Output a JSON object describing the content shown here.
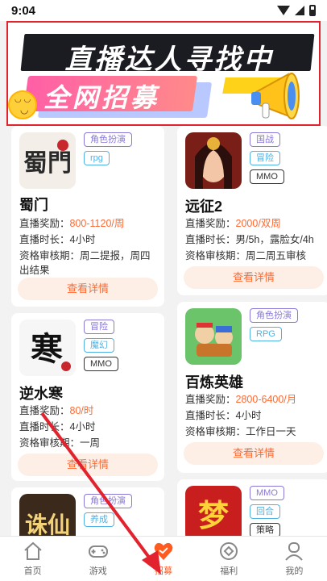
{
  "status": {
    "time": "9:04"
  },
  "banner": {
    "title": "直播达人寻找中",
    "subtitle": "全网招募"
  },
  "games": [
    {
      "name": "蜀门",
      "tags": [
        "角色扮演",
        "rpg"
      ],
      "reward_label": "直播奖励：",
      "reward": "800-1120/周",
      "duration": "直播时长：4小时",
      "review": "资格审核期：周二提报，周四出结果",
      "button": "查看详情"
    },
    {
      "name": "远征2",
      "tags": [
        "国战",
        "冒险",
        "MMO"
      ],
      "reward_label": "直播奖励：",
      "reward": "2000/双周",
      "duration": "直播时长：男/5h，露脸女/4h",
      "review": "资格审核期：周二周五审核",
      "button": "查看详情"
    },
    {
      "name": "逆水寒",
      "tags": [
        "冒险",
        "魔幻",
        "MMO"
      ],
      "reward_label": "直播奖励：",
      "reward": "80/时",
      "duration": "直播时长：4小时",
      "review": "资格审核期：一周",
      "button": "查看详情"
    },
    {
      "name": "百炼英雄",
      "tags": [
        "角色扮演",
        "RPG"
      ],
      "reward_label": "直播奖励：",
      "reward": "2800-6400/月",
      "duration": "直播时长：4小时",
      "review": "资格审核期：工作日一天",
      "button": "查看详情"
    },
    {
      "name": "",
      "tags": [
        "角色扮演",
        "养成"
      ]
    },
    {
      "name": "",
      "tags": [
        "MMO",
        "回合",
        "策略"
      ]
    }
  ],
  "thumbs": {
    "shumen": "蜀門",
    "nishuihan": "寒",
    "zhuxian": "诛仙",
    "meng": "梦"
  },
  "nav": [
    {
      "label": "首页",
      "icon": "home-icon"
    },
    {
      "label": "游戏",
      "icon": "gamepad-icon"
    },
    {
      "label": "招募",
      "icon": "recruit-icon"
    },
    {
      "label": "福利",
      "icon": "gift-icon"
    },
    {
      "label": "我的",
      "icon": "profile-icon"
    }
  ],
  "colors": {
    "accent": "#ff6a33",
    "annotation": "#e2222c"
  }
}
